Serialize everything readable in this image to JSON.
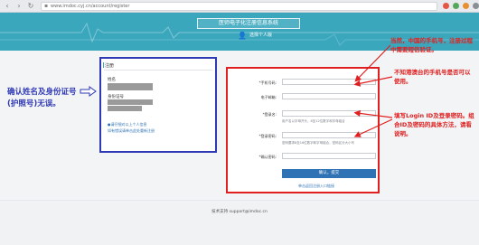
{
  "browser": {
    "url": "www.imdoc.cyj.cn/account/register",
    "lock_icon": "lock-icon"
  },
  "header": {
    "title": "医师电子化注册信息系统",
    "subtitle": "选择个人版",
    "user_icon": "user-icon"
  },
  "left_panel": {
    "title": "注册",
    "name_label": "姓名",
    "id_label": "身份证号",
    "note1": "●请仔细对以上个人信息",
    "note2": "如有错误请单击此处重新注册"
  },
  "form": {
    "phone_label": "*手机号码:",
    "email_label": "电子邮箱:",
    "login_label": "*登录名:",
    "login_hint": "用户名以字母开头，6至12位数字和字母组合",
    "password_label": "*登录密码:",
    "password_hint": "密码要求8至16位数字和字母组合，密码区分大小写",
    "confirm_label": "*确认密码:",
    "submit": "确认，提交",
    "link": "单击返回注册入口链接"
  },
  "annotations": {
    "left": "确认姓名及身份证号(护照号)无误。",
    "phone_note": "当然，中国的手机号，注册过程中需要短信验证。",
    "hk_note": "不知港澳台的手机号是否可以使用。",
    "login_note": "填写Login ID及登录密码。组合ID及密码的具体方法，请看说明。"
  },
  "footer": {
    "support": "技术支持 support@imdoc.cn"
  },
  "colors": {
    "banner": "#3aa7bd",
    "annotation_red": "#e02020",
    "annotation_blue": "#2f39b4",
    "button_blue": "#2f73b5"
  }
}
